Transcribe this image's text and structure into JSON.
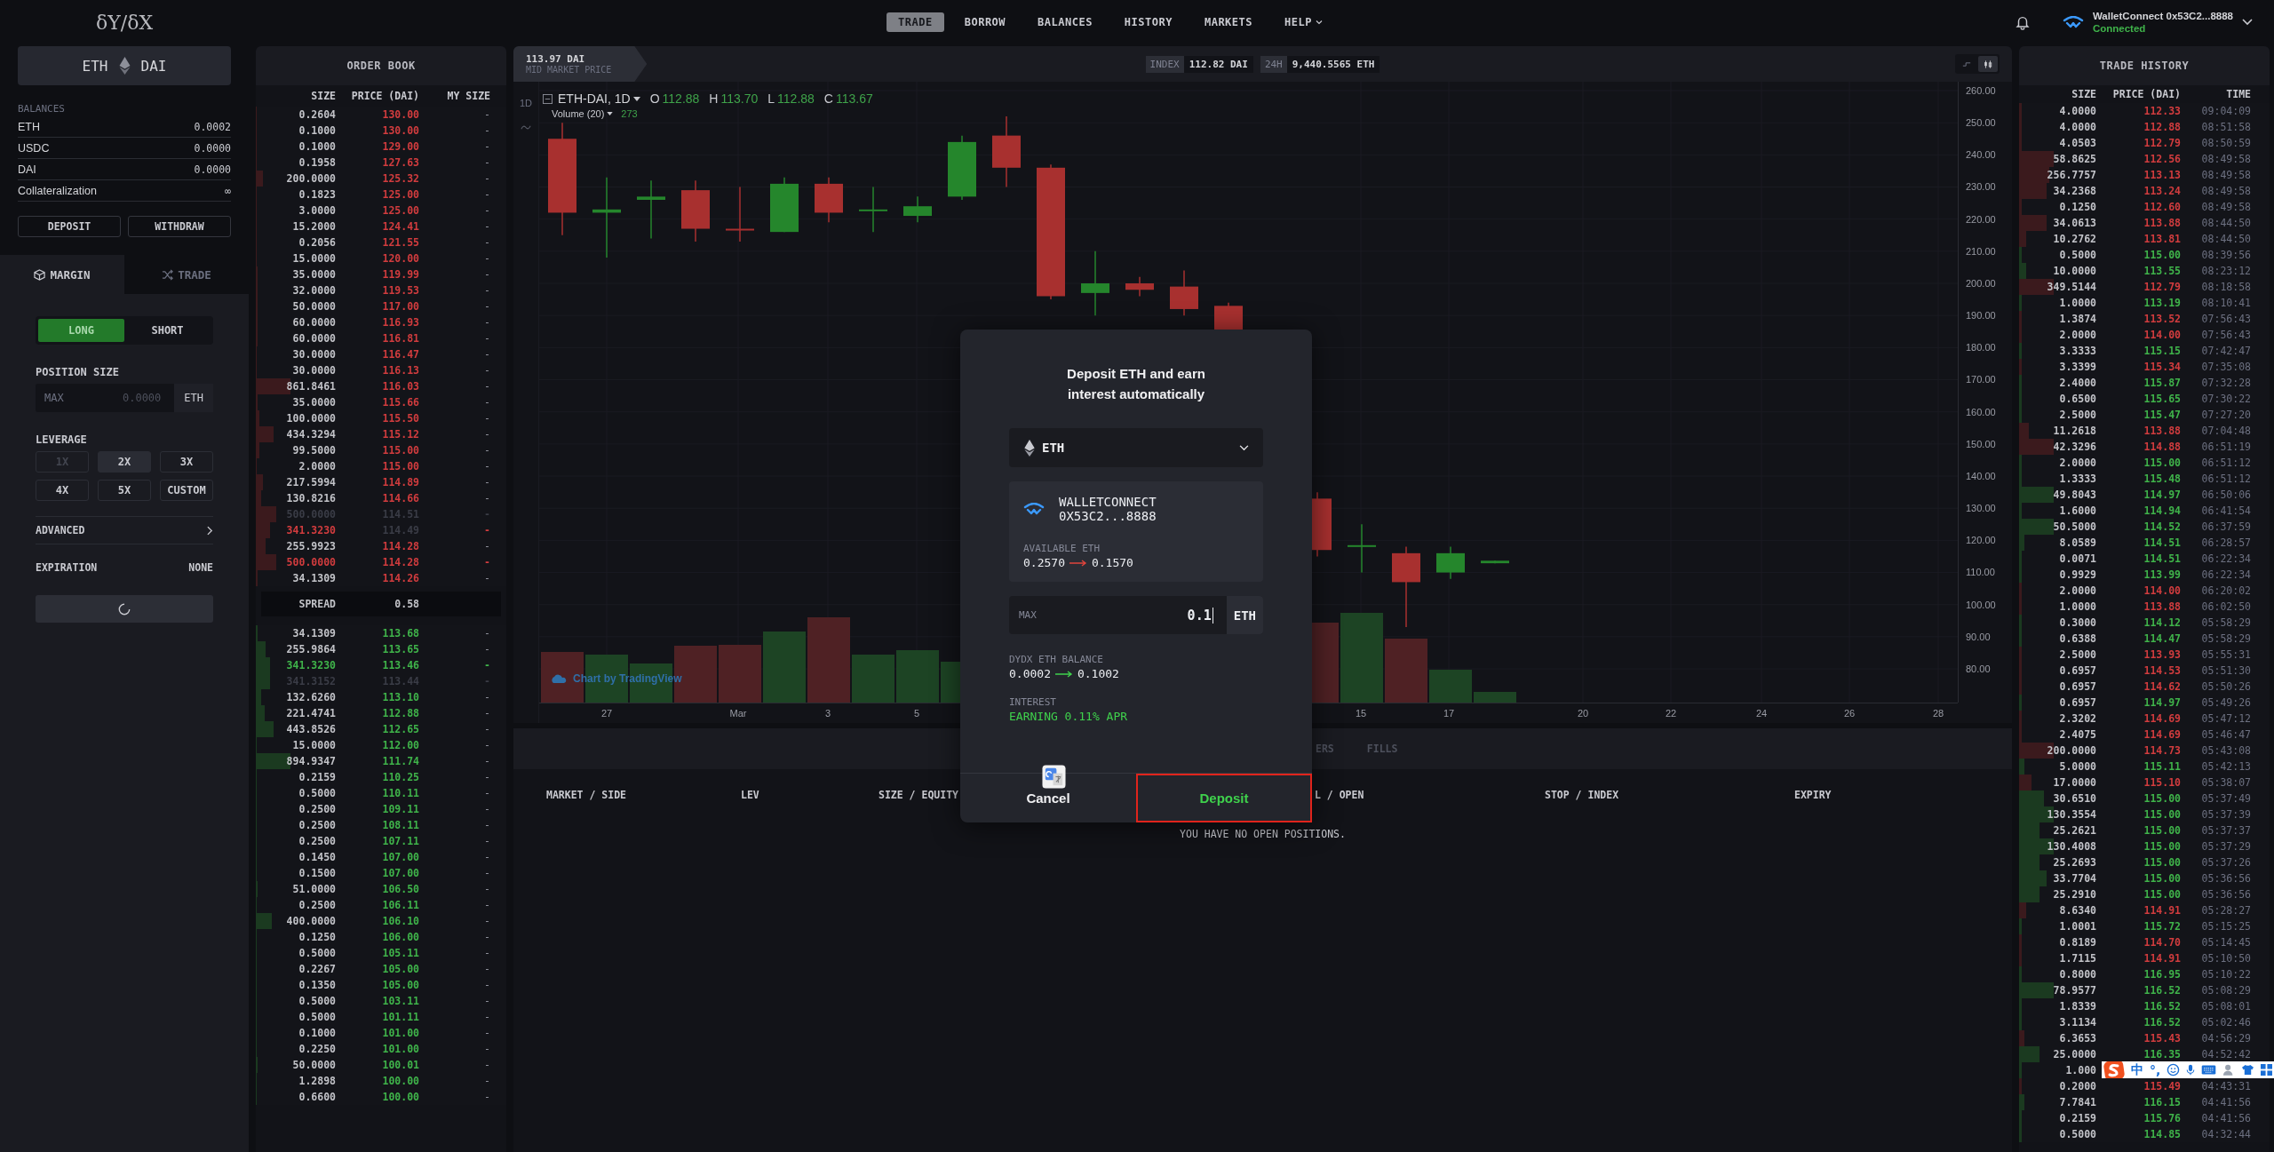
{
  "header": {
    "logo": "δY/δX",
    "nav": [
      {
        "label": "TRADE",
        "selected": true,
        "kind": "link"
      },
      {
        "label": "BORROW",
        "selected": false,
        "kind": "link"
      },
      {
        "label": "BALANCES",
        "selected": false,
        "kind": "link"
      },
      {
        "label": "HISTORY",
        "selected": false,
        "kind": "link"
      },
      {
        "label": "MARKETS",
        "selected": false,
        "kind": "link"
      },
      {
        "label": "HELP",
        "selected": false,
        "kind": "menu"
      }
    ],
    "wallet": {
      "name": "WalletConnect 0x53C2...8888",
      "status": "Connected"
    }
  },
  "market": {
    "base": "ETH",
    "quote": "DAI"
  },
  "balances": {
    "title": "BALANCES",
    "rows": [
      {
        "label": "ETH",
        "value": "0.0002"
      },
      {
        "label": "USDC",
        "value": "0.0000"
      },
      {
        "label": "DAI",
        "value": "0.0000"
      },
      {
        "label": "Collateralization",
        "value": "∞"
      }
    ],
    "buttons": [
      "DEPOSIT",
      "WITHDRAW"
    ]
  },
  "mode_tabs": [
    {
      "label": "MARGIN",
      "selected": true
    },
    {
      "label": "TRADE",
      "selected": false
    }
  ],
  "side": [
    {
      "label": "LONG",
      "selected": true
    },
    {
      "label": "SHORT",
      "selected": false
    }
  ],
  "position_size": {
    "label": "POSITION SIZE",
    "max": "MAX",
    "placeholder": "0.0000",
    "unit": "ETH"
  },
  "leverage": {
    "label": "LEVERAGE",
    "options": [
      {
        "label": "1X",
        "selected": false,
        "disabled": true
      },
      {
        "label": "2X",
        "selected": true,
        "disabled": false
      },
      {
        "label": "3X",
        "selected": false,
        "disabled": false
      },
      {
        "label": "4X",
        "selected": false,
        "disabled": false
      },
      {
        "label": "5X",
        "selected": false,
        "disabled": false
      },
      {
        "label": "CUSTOM",
        "selected": false,
        "disabled": false
      }
    ]
  },
  "advanced": "ADVANCED",
  "expiration": {
    "label": "EXPIRATION",
    "value": "NONE"
  },
  "submit": {
    "loading": true
  },
  "order_book": {
    "title": "ORDER BOOK",
    "columns": [
      "SIZE",
      "PRICE (DAI)",
      "MY SIZE"
    ],
    "asks": [
      {
        "size": "0.2604",
        "price": "130.00",
        "my_size": "-",
        "level": 0.005,
        "faded": false,
        "highlight": false
      },
      {
        "size": "0.1000",
        "price": "130.00",
        "my_size": "-",
        "level": 0.005,
        "faded": false,
        "highlight": false
      },
      {
        "size": "0.1000",
        "price": "129.00",
        "my_size": "-",
        "level": 0.005,
        "faded": false,
        "highlight": false
      },
      {
        "size": "0.1958",
        "price": "127.63",
        "my_size": "-",
        "level": 0.005,
        "faded": false,
        "highlight": false
      },
      {
        "size": "200.0000",
        "price": "125.32",
        "my_size": "-",
        "level": 0.03,
        "faded": false,
        "highlight": false
      },
      {
        "size": "0.1823",
        "price": "125.00",
        "my_size": "-",
        "level": 0.005,
        "faded": false,
        "highlight": false
      },
      {
        "size": "3.0000",
        "price": "125.00",
        "my_size": "-",
        "level": 0.005,
        "faded": false,
        "highlight": false
      },
      {
        "size": "15.2000",
        "price": "124.41",
        "my_size": "-",
        "level": 0.005,
        "faded": false,
        "highlight": false
      },
      {
        "size": "0.2056",
        "price": "121.55",
        "my_size": "-",
        "level": 0.005,
        "faded": false,
        "highlight": false
      },
      {
        "size": "15.0000",
        "price": "120.00",
        "my_size": "-",
        "level": 0.005,
        "faded": false,
        "highlight": false
      },
      {
        "size": "35.0000",
        "price": "119.99",
        "my_size": "-",
        "level": 0.006,
        "faded": false,
        "highlight": false
      },
      {
        "size": "32.0000",
        "price": "119.53",
        "my_size": "-",
        "level": 0.006,
        "faded": false,
        "highlight": false
      },
      {
        "size": "50.0000",
        "price": "117.00",
        "my_size": "-",
        "level": 0.006,
        "faded": false,
        "highlight": false
      },
      {
        "size": "60.0000",
        "price": "116.93",
        "my_size": "-",
        "level": 0.008,
        "faded": false,
        "highlight": false
      },
      {
        "size": "60.0000",
        "price": "116.81",
        "my_size": "-",
        "level": 0.008,
        "faded": false,
        "highlight": false
      },
      {
        "size": "30.0000",
        "price": "116.47",
        "my_size": "-",
        "level": 0.005,
        "faded": false,
        "highlight": false
      },
      {
        "size": "30.0000",
        "price": "116.13",
        "my_size": "-",
        "level": 0.005,
        "faded": false,
        "highlight": false
      },
      {
        "size": "861.8461",
        "price": "116.03",
        "my_size": "-",
        "level": 0.14,
        "faded": false,
        "highlight": false
      },
      {
        "size": "35.0000",
        "price": "115.66",
        "my_size": "-",
        "level": 0.006,
        "faded": false,
        "highlight": false
      },
      {
        "size": "100.0000",
        "price": "115.50",
        "my_size": "-",
        "level": 0.015,
        "faded": false,
        "highlight": false
      },
      {
        "size": "434.3294",
        "price": "115.12",
        "my_size": "-",
        "level": 0.07,
        "faded": false,
        "highlight": false
      },
      {
        "size": "99.5000",
        "price": "115.00",
        "my_size": "-",
        "level": 0.015,
        "faded": false,
        "highlight": false
      },
      {
        "size": "2.0000",
        "price": "115.00",
        "my_size": "-",
        "level": 0.005,
        "faded": false,
        "highlight": false
      },
      {
        "size": "217.5994",
        "price": "114.89",
        "my_size": "-",
        "level": 0.03,
        "faded": false,
        "highlight": false
      },
      {
        "size": "130.8216",
        "price": "114.66",
        "my_size": "-",
        "level": 0.02,
        "faded": false,
        "highlight": false
      },
      {
        "size": "500.0000",
        "price": "114.51",
        "my_size": "-",
        "level": 0.08,
        "faded": true,
        "highlight": false
      },
      {
        "size": "341.3230",
        "price": "114.49",
        "my_size": "-",
        "level": 0.055,
        "faded": true,
        "highlight": true
      },
      {
        "size": "255.9923",
        "price": "114.28",
        "my_size": "-",
        "level": 0.04,
        "faded": false,
        "highlight": false
      },
      {
        "size": "500.0000",
        "price": "114.28",
        "my_size": "-",
        "level": 0.08,
        "faded": false,
        "highlight": true
      },
      {
        "size": "34.1309",
        "price": "114.26",
        "my_size": "-",
        "level": 0.006,
        "faded": false,
        "highlight": false
      }
    ],
    "spread": {
      "label": "SPREAD",
      "value": "0.58"
    },
    "bids": [
      {
        "size": "34.1309",
        "price": "113.68",
        "my_size": "-",
        "level": 0.006,
        "faded": false,
        "highlight": false
      },
      {
        "size": "255.9864",
        "price": "113.65",
        "my_size": "-",
        "level": 0.04,
        "faded": false,
        "highlight": false
      },
      {
        "size": "341.3230",
        "price": "113.46",
        "my_size": "-",
        "level": 0.055,
        "faded": false,
        "highlight": true
      },
      {
        "size": "341.3152",
        "price": "113.44",
        "my_size": "-",
        "level": 0.055,
        "faded": true,
        "highlight": false
      },
      {
        "size": "132.6260",
        "price": "113.10",
        "my_size": "-",
        "level": 0.02,
        "faded": false,
        "highlight": false
      },
      {
        "size": "221.4741",
        "price": "112.88",
        "my_size": "-",
        "level": 0.035,
        "faded": false,
        "highlight": false
      },
      {
        "size": "443.8526",
        "price": "112.65",
        "my_size": "-",
        "level": 0.07,
        "faded": false,
        "highlight": false
      },
      {
        "size": "15.0000",
        "price": "112.00",
        "my_size": "-",
        "level": 0.005,
        "faded": false,
        "highlight": false
      },
      {
        "size": "894.9347",
        "price": "111.74",
        "my_size": "-",
        "level": 0.14,
        "faded": false,
        "highlight": false
      },
      {
        "size": "0.2159",
        "price": "110.25",
        "my_size": "-",
        "level": 0.005,
        "faded": false,
        "highlight": false
      },
      {
        "size": "0.5000",
        "price": "110.11",
        "my_size": "-",
        "level": 0.005,
        "faded": false,
        "highlight": false
      },
      {
        "size": "0.2500",
        "price": "109.11",
        "my_size": "-",
        "level": 0.005,
        "faded": false,
        "highlight": false
      },
      {
        "size": "0.2500",
        "price": "108.11",
        "my_size": "-",
        "level": 0.005,
        "faded": false,
        "highlight": false
      },
      {
        "size": "0.2500",
        "price": "107.11",
        "my_size": "-",
        "level": 0.005,
        "faded": false,
        "highlight": false
      },
      {
        "size": "0.1450",
        "price": "107.00",
        "my_size": "-",
        "level": 0.005,
        "faded": false,
        "highlight": false
      },
      {
        "size": "0.1500",
        "price": "107.00",
        "my_size": "-",
        "level": 0.005,
        "faded": false,
        "highlight": false
      },
      {
        "size": "51.0000",
        "price": "106.50",
        "my_size": "-",
        "level": 0.008,
        "faded": false,
        "highlight": false
      },
      {
        "size": "0.2500",
        "price": "106.11",
        "my_size": "-",
        "level": 0.005,
        "faded": false,
        "highlight": false
      },
      {
        "size": "400.0000",
        "price": "106.10",
        "my_size": "-",
        "level": 0.065,
        "faded": false,
        "highlight": false
      },
      {
        "size": "0.1250",
        "price": "106.00",
        "my_size": "-",
        "level": 0.005,
        "faded": false,
        "highlight": false
      },
      {
        "size": "0.5000",
        "price": "105.11",
        "my_size": "-",
        "level": 0.005,
        "faded": false,
        "highlight": false
      },
      {
        "size": "0.2267",
        "price": "105.00",
        "my_size": "-",
        "level": 0.005,
        "faded": false,
        "highlight": false
      },
      {
        "size": "0.1350",
        "price": "105.00",
        "my_size": "-",
        "level": 0.005,
        "faded": false,
        "highlight": false
      },
      {
        "size": "0.5000",
        "price": "103.11",
        "my_size": "-",
        "level": 0.005,
        "faded": false,
        "highlight": false
      },
      {
        "size": "0.5000",
        "price": "101.11",
        "my_size": "-",
        "level": 0.005,
        "faded": false,
        "highlight": false
      },
      {
        "size": "0.1000",
        "price": "101.00",
        "my_size": "-",
        "level": 0.005,
        "faded": false,
        "highlight": false
      },
      {
        "size": "0.2250",
        "price": "101.00",
        "my_size": "-",
        "level": 0.005,
        "faded": false,
        "highlight": false
      },
      {
        "size": "50.0000",
        "price": "100.01",
        "my_size": "-",
        "level": 0.008,
        "faded": false,
        "highlight": false
      },
      {
        "size": "1.2898",
        "price": "100.00",
        "my_size": "-",
        "level": 0.005,
        "faded": false,
        "highlight": false
      },
      {
        "size": "0.6600",
        "price": "100.00",
        "my_size": "-",
        "level": 0.005,
        "faded": false,
        "highlight": false
      }
    ]
  },
  "market_bar": {
    "price": "113.97 DAI",
    "price_label": "MID MARKET PRICE",
    "stats": [
      {
        "label": "INDEX",
        "value": "112.82 DAI"
      },
      {
        "label": "24H",
        "value": "9,440.5565 ETH"
      }
    ],
    "chart_types": [
      {
        "selected": false
      },
      {
        "selected": true
      }
    ]
  },
  "chart": {
    "interval": "1D",
    "symbol": "ETH-DAI, 1D",
    "ohlc": [
      {
        "label": "O",
        "value": "112.88"
      },
      {
        "label": "H",
        "value": "113.70"
      },
      {
        "label": "L",
        "value": "112.88"
      },
      {
        "label": "C",
        "value": "113.67"
      }
    ],
    "volume_label": "Volume (20)",
    "volume_value": "273",
    "attribution": "Chart by TradingView",
    "yticks": [
      "260.00",
      "250.00",
      "240.00",
      "230.00",
      "220.00",
      "210.00",
      "200.00",
      "190.00",
      "180.00",
      "170.00",
      "160.00",
      "150.00",
      "140.00",
      "130.00",
      "120.00",
      "110.00",
      "100.00",
      "90.00",
      "80.00"
    ],
    "xticks": [
      "27",
      "Mar",
      "3",
      "5",
      "15",
      "17",
      "20",
      "22",
      "24",
      "26",
      "28"
    ]
  },
  "positions": {
    "tabs": [
      {
        "label": "ERS",
        "selected": false
      },
      {
        "label": "FILLS",
        "selected": false
      }
    ],
    "columns": [
      "MARKET / SIDE",
      "LEV",
      "SIZE / EQUITY",
      "L / OPEN",
      "STOP / INDEX",
      "EXPIRY"
    ],
    "empty": "YOU HAVE NO OPEN POSITIONS."
  },
  "trade_history": {
    "title": "TRADE HISTORY",
    "columns": [
      "SIZE",
      "PRICE (DAI)",
      "TIME"
    ],
    "rows": [
      {
        "size": "4.0000",
        "price": "112.33",
        "time": "09:04:09",
        "color": "#d13c3e",
        "level": 0.01
      },
      {
        "size": "4.0000",
        "price": "112.88",
        "time": "08:51:58",
        "color": "#d13c3e",
        "level": 0.01
      },
      {
        "size": "4.0503",
        "price": "112.79",
        "time": "08:50:59",
        "color": "#d13c3e",
        "level": 0.01
      },
      {
        "size": "58.8625",
        "price": "112.56",
        "time": "08:49:58",
        "color": "#d13c3e",
        "level": 0.14
      },
      {
        "size": "256.7757",
        "price": "113.13",
        "time": "08:49:58",
        "color": "#d13c3e",
        "level": 0.12
      },
      {
        "size": "34.2368",
        "price": "113.24",
        "time": "08:49:58",
        "color": "#d13c3e",
        "level": 0.11
      },
      {
        "size": "0.1250",
        "price": "112.60",
        "time": "08:49:58",
        "color": "#d13c3e",
        "level": 0.01
      },
      {
        "size": "34.0613",
        "price": "113.88",
        "time": "08:44:50",
        "color": "#d13c3e",
        "level": 0.11
      },
      {
        "size": "10.2762",
        "price": "113.81",
        "time": "08:44:50",
        "color": "#d13c3e",
        "level": 0.03
      },
      {
        "size": "0.5000",
        "price": "115.00",
        "time": "08:39:56",
        "color": "#3fb34a",
        "level": 0.01
      },
      {
        "size": "10.0000",
        "price": "113.55",
        "time": "08:23:12",
        "color": "#3fb34a",
        "level": 0.03
      },
      {
        "size": "349.5144",
        "price": "112.79",
        "time": "08:18:58",
        "color": "#d13c3e",
        "level": 0.14
      },
      {
        "size": "1.0000",
        "price": "113.19",
        "time": "08:10:41",
        "color": "#3fb34a",
        "level": 0.01
      },
      {
        "size": "1.3874",
        "price": "113.52",
        "time": "07:56:43",
        "color": "#d13c3e",
        "level": 0.01
      },
      {
        "size": "2.0000",
        "price": "114.00",
        "time": "07:56:43",
        "color": "#d13c3e",
        "level": 0.01
      },
      {
        "size": "3.3333",
        "price": "115.15",
        "time": "07:42:47",
        "color": "#3fb34a",
        "level": 0.01
      },
      {
        "size": "3.3399",
        "price": "115.34",
        "time": "07:35:08",
        "color": "#d13c3e",
        "level": 0.01
      },
      {
        "size": "2.4000",
        "price": "115.87",
        "time": "07:32:28",
        "color": "#3fb34a",
        "level": 0.01
      },
      {
        "size": "0.6500",
        "price": "115.65",
        "time": "07:30:22",
        "color": "#3fb34a",
        "level": 0.01
      },
      {
        "size": "2.5000",
        "price": "115.47",
        "time": "07:27:20",
        "color": "#3fb34a",
        "level": 0.01
      },
      {
        "size": "11.2618",
        "price": "113.88",
        "time": "07:04:48",
        "color": "#d13c3e",
        "level": 0.04
      },
      {
        "size": "42.3296",
        "price": "114.88",
        "time": "06:51:19",
        "color": "#d13c3e",
        "level": 0.14
      },
      {
        "size": "2.0000",
        "price": "115.00",
        "time": "06:51:12",
        "color": "#3fb34a",
        "level": 0.01
      },
      {
        "size": "1.3333",
        "price": "115.48",
        "time": "06:51:12",
        "color": "#3fb34a",
        "level": 0.01
      },
      {
        "size": "49.8043",
        "price": "114.97",
        "time": "06:50:06",
        "color": "#3fb34a",
        "level": 0.14
      },
      {
        "size": "1.6000",
        "price": "114.94",
        "time": "06:41:54",
        "color": "#3fb34a",
        "level": 0.01
      },
      {
        "size": "50.5000",
        "price": "114.52",
        "time": "06:37:59",
        "color": "#3fb34a",
        "level": 0.14
      },
      {
        "size": "8.0589",
        "price": "114.51",
        "time": "06:28:57",
        "color": "#3fb34a",
        "level": 0.02
      },
      {
        "size": "0.0071",
        "price": "114.51",
        "time": "06:22:34",
        "color": "#3fb34a",
        "level": 0.01
      },
      {
        "size": "0.9929",
        "price": "113.99",
        "time": "06:22:34",
        "color": "#3fb34a",
        "level": 0.01
      },
      {
        "size": "2.0000",
        "price": "114.00",
        "time": "06:20:02",
        "color": "#d13c3e",
        "level": 0.01
      },
      {
        "size": "1.0000",
        "price": "113.88",
        "time": "06:02:50",
        "color": "#d13c3e",
        "level": 0.01
      },
      {
        "size": "0.3000",
        "price": "114.12",
        "time": "05:58:29",
        "color": "#3fb34a",
        "level": 0.01
      },
      {
        "size": "0.6388",
        "price": "114.47",
        "time": "05:58:29",
        "color": "#3fb34a",
        "level": 0.01
      },
      {
        "size": "2.5000",
        "price": "113.93",
        "time": "05:55:31",
        "color": "#d13c3e",
        "level": 0.01
      },
      {
        "size": "0.6957",
        "price": "114.53",
        "time": "05:51:30",
        "color": "#d13c3e",
        "level": 0.01
      },
      {
        "size": "0.6957",
        "price": "114.62",
        "time": "05:50:26",
        "color": "#d13c3e",
        "level": 0.01
      },
      {
        "size": "0.6957",
        "price": "114.97",
        "time": "05:49:26",
        "color": "#3fb34a",
        "level": 0.01
      },
      {
        "size": "2.3202",
        "price": "114.69",
        "time": "05:47:12",
        "color": "#d13c3e",
        "level": 0.01
      },
      {
        "size": "2.4075",
        "price": "114.69",
        "time": "05:46:47",
        "color": "#d13c3e",
        "level": 0.01
      },
      {
        "size": "200.0000",
        "price": "114.73",
        "time": "05:43:08",
        "color": "#d13c3e",
        "level": 0.14
      },
      {
        "size": "5.0000",
        "price": "115.11",
        "time": "05:42:13",
        "color": "#3fb34a",
        "level": 0.02
      },
      {
        "size": "17.0000",
        "price": "115.10",
        "time": "05:38:07",
        "color": "#d13c3e",
        "level": 0.05
      },
      {
        "size": "30.6510",
        "price": "115.00",
        "time": "05:37:49",
        "color": "#3fb34a",
        "level": 0.1
      },
      {
        "size": "130.3554",
        "price": "115.00",
        "time": "05:37:39",
        "color": "#3fb34a",
        "level": 0.14
      },
      {
        "size": "25.2621",
        "price": "115.00",
        "time": "05:37:37",
        "color": "#3fb34a",
        "level": 0.08
      },
      {
        "size": "130.4008",
        "price": "115.00",
        "time": "05:37:29",
        "color": "#3fb34a",
        "level": 0.14
      },
      {
        "size": "25.2693",
        "price": "115.00",
        "time": "05:37:26",
        "color": "#3fb34a",
        "level": 0.08
      },
      {
        "size": "33.7704",
        "price": "115.00",
        "time": "05:36:56",
        "color": "#3fb34a",
        "level": 0.11
      },
      {
        "size": "25.2910",
        "price": "115.00",
        "time": "05:36:56",
        "color": "#3fb34a",
        "level": 0.08
      },
      {
        "size": "8.6340",
        "price": "114.91",
        "time": "05:28:27",
        "color": "#d13c3e",
        "level": 0.03
      },
      {
        "size": "1.0001",
        "price": "115.72",
        "time": "05:15:25",
        "color": "#3fb34a",
        "level": 0.01
      },
      {
        "size": "0.8189",
        "price": "114.70",
        "time": "05:14:45",
        "color": "#d13c3e",
        "level": 0.01
      },
      {
        "size": "1.7115",
        "price": "114.91",
        "time": "05:10:50",
        "color": "#d13c3e",
        "level": 0.01
      },
      {
        "size": "0.8000",
        "price": "116.95",
        "time": "05:10:22",
        "color": "#3fb34a",
        "level": 0.01
      },
      {
        "size": "78.9577",
        "price": "116.52",
        "time": "05:08:29",
        "color": "#3fb34a",
        "level": 0.14
      },
      {
        "size": "1.8339",
        "price": "116.52",
        "time": "05:08:01",
        "color": "#3fb34a",
        "level": 0.01
      },
      {
        "size": "3.1134",
        "price": "116.52",
        "time": "05:02:46",
        "color": "#3fb34a",
        "level": 0.01
      },
      {
        "size": "6.3653",
        "price": "115.43",
        "time": "04:56:29",
        "color": "#d13c3e",
        "level": 0.02
      },
      {
        "size": "25.0000",
        "price": "116.35",
        "time": "04:52:42",
        "color": "#3fb34a",
        "level": 0.08
      },
      {
        "size": "1.000",
        "level": 0.01
      },
      {
        "size": "0.2000",
        "price": "115.49",
        "time": "04:43:31",
        "color": "#d13c3e",
        "level": 0.01
      },
      {
        "size": "7.7841",
        "price": "116.15",
        "time": "04:41:56",
        "color": "#3fb34a",
        "level": 0.02
      },
      {
        "size": "0.2159",
        "price": "115.76",
        "time": "04:41:56",
        "color": "#3fb34a",
        "level": 0.01
      },
      {
        "size": "0.5000",
        "price": "114.85",
        "time": "04:32:44",
        "color": "#3fb34a",
        "level": 0.01
      }
    ]
  },
  "deposit_dialog": {
    "title": "Deposit ETH and earn interest automatically",
    "asset": "ETH",
    "wallet_name": "WALLETCONNECT",
    "wallet_address": "0X53C2...8888",
    "available": {
      "label": "AVAILABLE ETH",
      "from": "0.2570",
      "to": "0.1570",
      "color": "#e0443c"
    },
    "amount": {
      "max": "MAX",
      "value": "0.1",
      "unit": "ETH"
    },
    "balance": {
      "label": "DYDX ETH BALANCE",
      "from": "0.0002",
      "to": "0.1002",
      "color": "#3fd14c"
    },
    "interest": {
      "label": "INTEREST",
      "value": "EARNING 0.11% APR"
    },
    "buttons": [
      {
        "label": "Cancel",
        "kind": "cancel",
        "highlighted": false
      },
      {
        "label": "Deposit",
        "kind": "confirm",
        "highlighted": true
      }
    ]
  },
  "ime_toolbar": {
    "texts": [
      "中",
      "°,"
    ]
  }
}
